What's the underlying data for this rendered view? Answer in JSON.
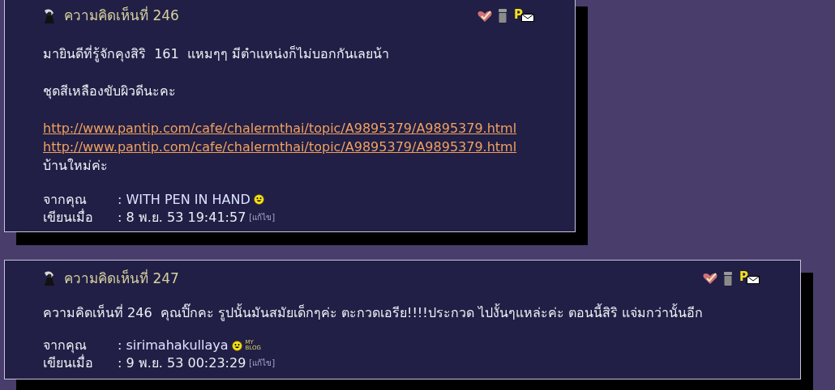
{
  "comments": [
    {
      "title": "ความคิดเห็นที่ 246",
      "pm_label": "P",
      "body": [
        {
          "kind": "text",
          "text": "มายินดีที่รู้จักคุงสิริ  161  แหมๆๆ มีตำแหน่งก็ไม่บอกกันเลยน้า"
        },
        {
          "kind": "gap"
        },
        {
          "kind": "text",
          "text": "ชุดสีเหลืองขับผิวดีนะคะ"
        },
        {
          "kind": "gap"
        },
        {
          "kind": "link",
          "text": "http://www.pantip.com/cafe/chalermthai/topic/A9895379/A9895379.html"
        },
        {
          "kind": "link",
          "text": "http://www.pantip.com/cafe/chalermthai/topic/A9895379/A9895379.html"
        },
        {
          "kind": "text",
          "text": "บ้านใหม่ค่ะ"
        }
      ],
      "from_label": "จากคุณ",
      "author": ": WITH PEN IN HAND",
      "date_label": "เขียนเมื่อ",
      "date": ": 8 พ.ย. 53 19:41:57",
      "edit": "[แก้ไข]"
    },
    {
      "title": "ความคิดเห็นที่ 247",
      "pm_label": "P",
      "body": [
        {
          "kind": "text",
          "text": "ความคิดเห็นที่ 246  คุณปิ๊กคะ รูปนั้นมันสมัยเด็กๆค่ะ ตะกวดเอรีย!!!!ประกวด ไปงั้นๆแหล่ะค่ะ ตอนนี้สิริ แจ่มกว่านั้นอีก"
        }
      ],
      "from_label": "จากคุณ",
      "author": ": sirimahakullaya",
      "blog_badge": "MY BLOG",
      "date_label": "เขียนเมื่อ",
      "date": ": 9 พ.ย. 53 00:23:29",
      "edit": "[แก้ไข]"
    }
  ]
}
